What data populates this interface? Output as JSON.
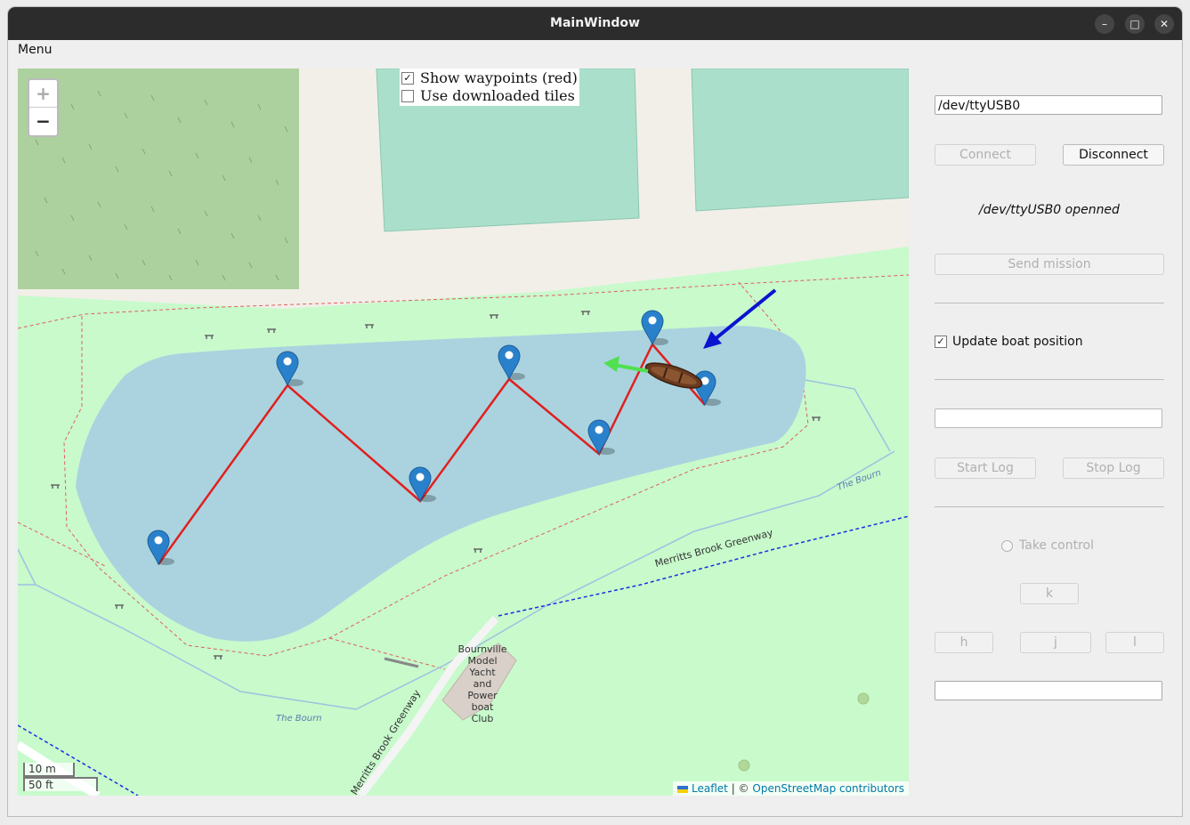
{
  "window": {
    "title": "MainWindow",
    "controls": {
      "minimize": "–",
      "maximize": "□",
      "close": "✕"
    }
  },
  "menu": {
    "label": "Menu"
  },
  "map": {
    "zoom_in": "+",
    "zoom_out": "−",
    "options": [
      {
        "label": "Show waypoints (red)",
        "checked": true
      },
      {
        "label": "Use downloaded tiles",
        "checked": false
      }
    ],
    "scale_metric": "10 m",
    "scale_imperial": "50 ft",
    "attribution": {
      "leaflet": "Leaflet",
      "separator": " | © ",
      "osm": "OpenStreetMap contributors"
    },
    "labels": {
      "greenway_1": "Merritts Brook Greenway",
      "greenway_2": "Merritts Brook Greenway",
      "stream_1": "The Bourn",
      "stream_2": "The Bourn",
      "club": [
        "Bournville",
        "Model",
        "Yacht",
        "and",
        "Power",
        "boat",
        "Club"
      ]
    },
    "waypoint_count": 7
  },
  "panel": {
    "port_value": "/dev/ttyUSB0",
    "connect_label": "Connect",
    "disconnect_label": "Disconnect",
    "status_text": "/dev/ttyUSB0 openned",
    "send_mission_label": "Send mission",
    "update_boat_label": "Update boat position",
    "update_boat_checked": true,
    "log_input_value": "",
    "start_log_label": "Start Log",
    "stop_log_label": "Stop Log",
    "take_control_label": "Take control",
    "key_k": "k",
    "key_h": "h",
    "key_j": "j",
    "key_l": "l",
    "bottom_input_value": ""
  },
  "colors": {
    "route": "#e02020",
    "heading_arrow": "#50e050",
    "target_arrow": "#0a14d0",
    "water": "#aad3df",
    "park": "#c8facc"
  }
}
